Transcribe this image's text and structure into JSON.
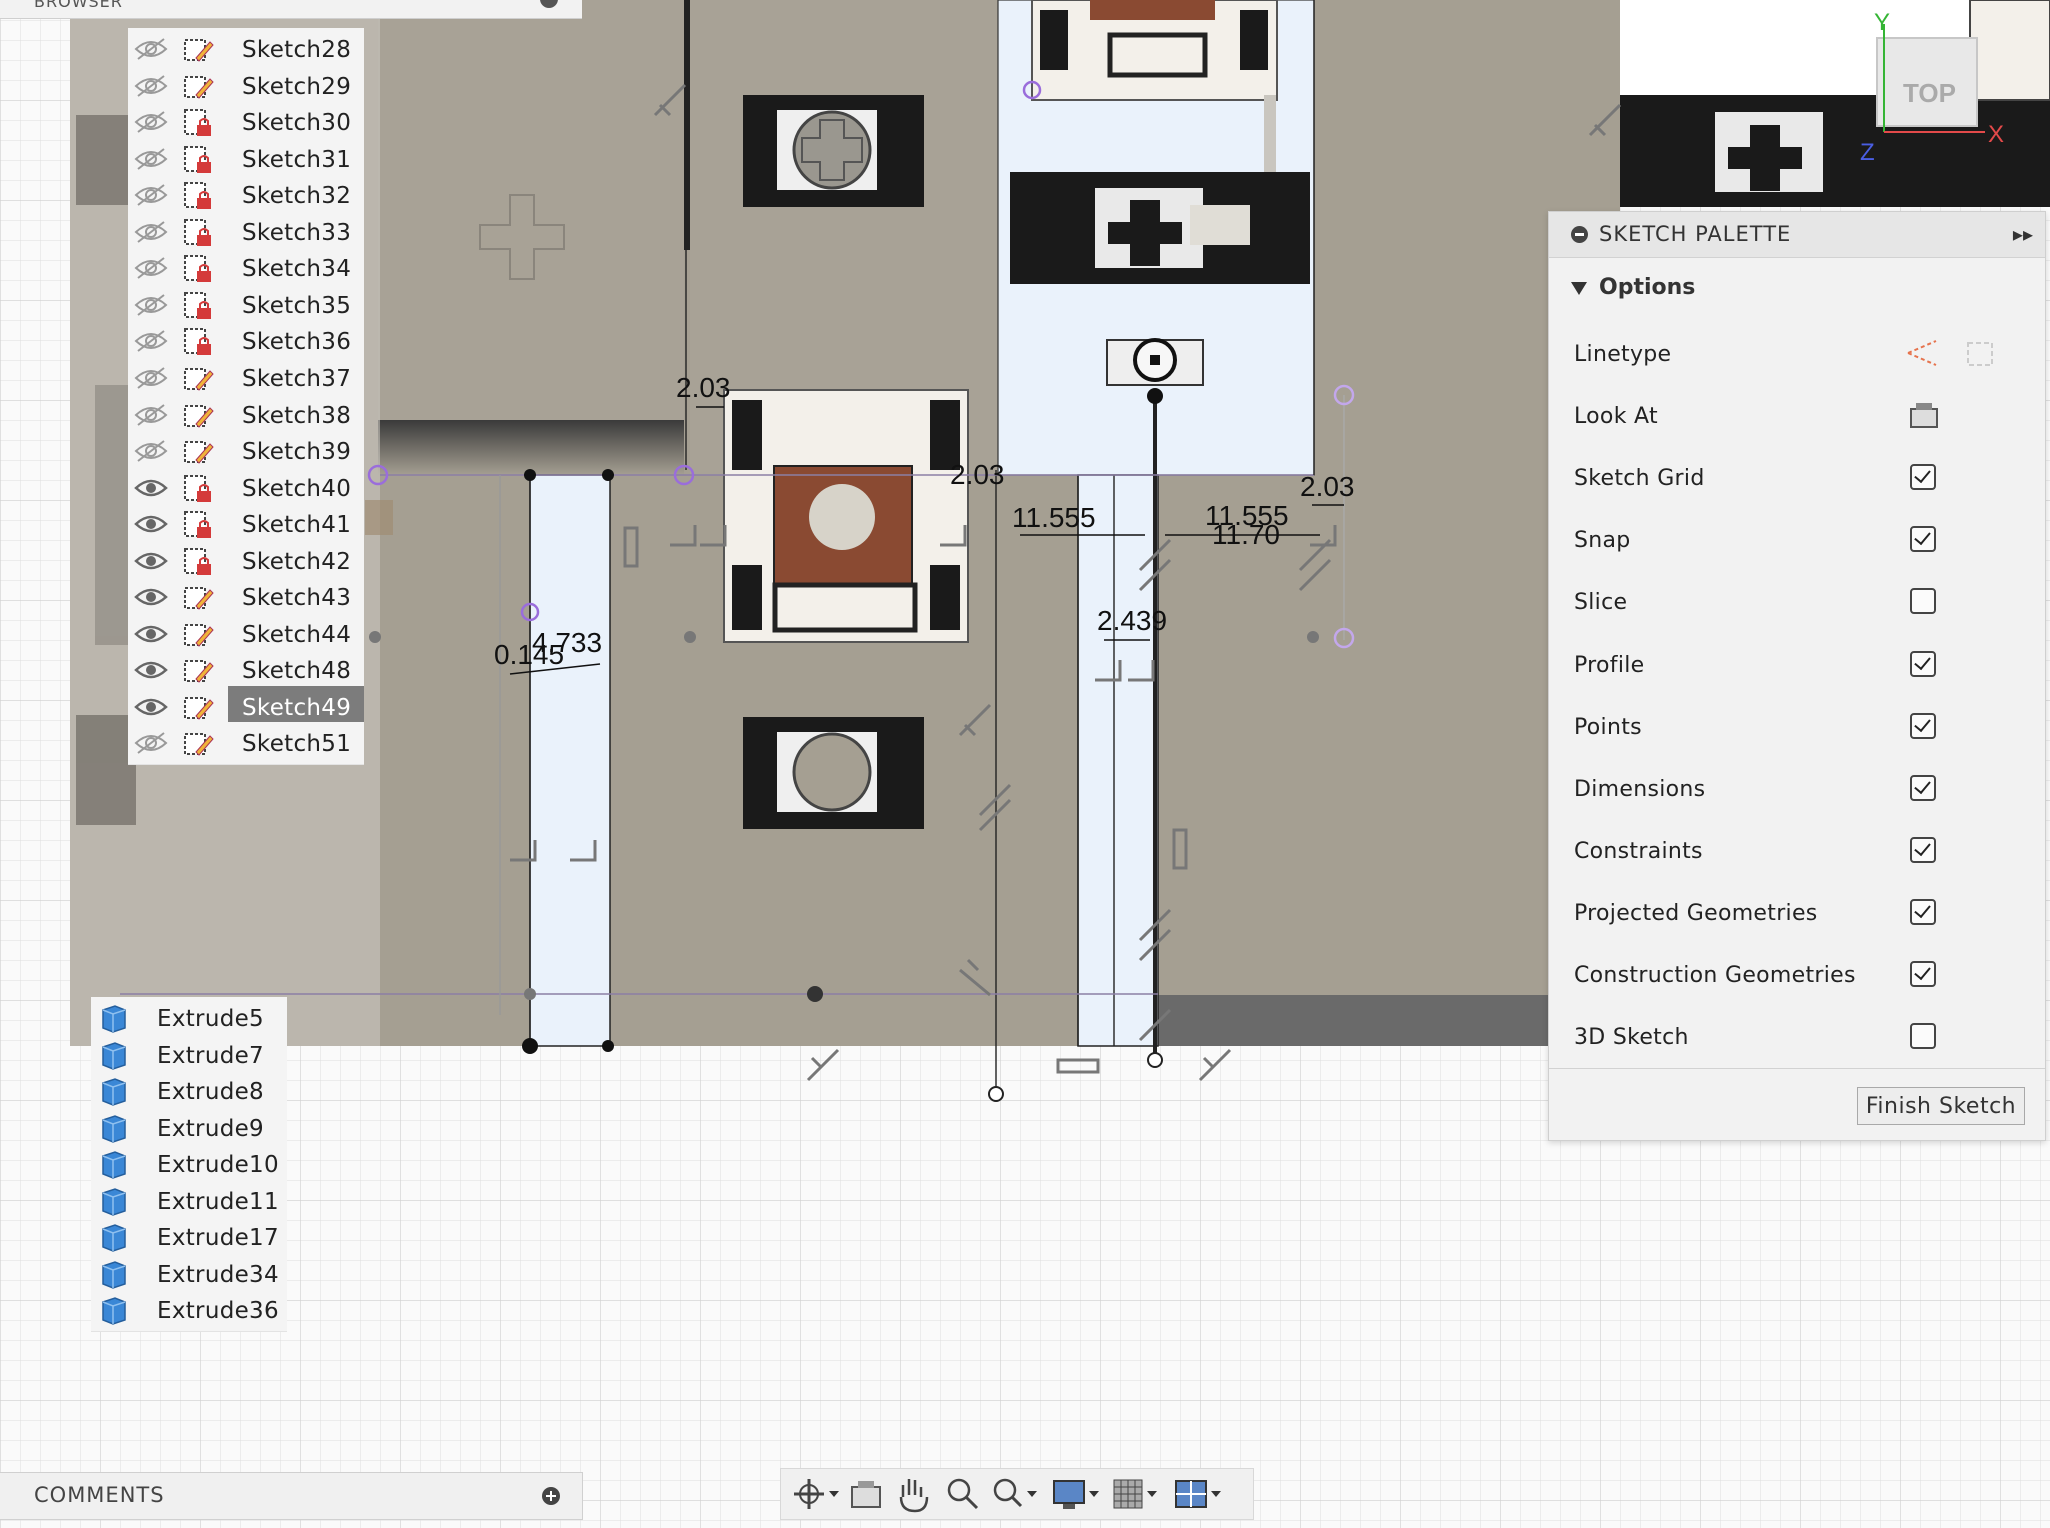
{
  "browser": {
    "header": "BROWSER",
    "sketches": [
      {
        "label": "Sketch28",
        "visible": false,
        "locked": false
      },
      {
        "label": "Sketch29",
        "visible": false,
        "locked": false
      },
      {
        "label": "Sketch30",
        "visible": false,
        "locked": true
      },
      {
        "label": "Sketch31",
        "visible": false,
        "locked": true
      },
      {
        "label": "Sketch32",
        "visible": false,
        "locked": true
      },
      {
        "label": "Sketch33",
        "visible": false,
        "locked": true
      },
      {
        "label": "Sketch34",
        "visible": false,
        "locked": true
      },
      {
        "label": "Sketch35",
        "visible": false,
        "locked": true
      },
      {
        "label": "Sketch36",
        "visible": false,
        "locked": true
      },
      {
        "label": "Sketch37",
        "visible": false,
        "locked": false
      },
      {
        "label": "Sketch38",
        "visible": false,
        "locked": false
      },
      {
        "label": "Sketch39",
        "visible": false,
        "locked": false
      },
      {
        "label": "Sketch40",
        "visible": true,
        "locked": true
      },
      {
        "label": "Sketch41",
        "visible": true,
        "locked": true
      },
      {
        "label": "Sketch42",
        "visible": true,
        "locked": true
      },
      {
        "label": "Sketch43",
        "visible": true,
        "locked": false
      },
      {
        "label": "Sketch44",
        "visible": true,
        "locked": false
      },
      {
        "label": "Sketch48",
        "visible": true,
        "locked": false
      },
      {
        "label": "Sketch49",
        "visible": true,
        "locked": false,
        "selected": true
      },
      {
        "label": "Sketch51",
        "visible": false,
        "locked": false
      }
    ],
    "bodies": [
      {
        "label": "Extrude5"
      },
      {
        "label": "Extrude7"
      },
      {
        "label": "Extrude8"
      },
      {
        "label": "Extrude9"
      },
      {
        "label": "Extrude10"
      },
      {
        "label": "Extrude11"
      },
      {
        "label": "Extrude17"
      },
      {
        "label": "Extrude34"
      },
      {
        "label": "Extrude36"
      }
    ]
  },
  "canvas": {
    "dimensions": [
      "2.03",
      "2.03",
      "11.555",
      "11.555",
      "2.03",
      "11.70",
      "4.733",
      "0.145",
      "2.439"
    ]
  },
  "viewcube": {
    "face": "TOP",
    "axis_y": "Y",
    "axis_x": "X",
    "axis_z": "Z"
  },
  "palette": {
    "title": "SKETCH PALETTE",
    "options_heading": "Options",
    "rows": [
      {
        "label": "Linetype",
        "control": "icons",
        "icon": "linetype-icon"
      },
      {
        "label": "Look At",
        "control": "icon",
        "icon": "look-at-icon"
      },
      {
        "label": "Sketch Grid",
        "control": "checkbox",
        "checked": true
      },
      {
        "label": "Snap",
        "control": "checkbox",
        "checked": true
      },
      {
        "label": "Slice",
        "control": "checkbox",
        "checked": false
      },
      {
        "label": "Profile",
        "control": "checkbox",
        "checked": true
      },
      {
        "label": "Points",
        "control": "checkbox",
        "checked": true
      },
      {
        "label": "Dimensions",
        "control": "checkbox",
        "checked": true
      },
      {
        "label": "Constraints",
        "control": "checkbox",
        "checked": true
      },
      {
        "label": "Projected Geometries",
        "control": "checkbox",
        "checked": true
      },
      {
        "label": "Construction Geometries",
        "control": "checkbox",
        "checked": true
      },
      {
        "label": "3D Sketch",
        "control": "checkbox",
        "checked": false
      }
    ],
    "finish_label": "Finish Sketch"
  },
  "comments": {
    "label": "COMMENTS"
  },
  "navbar": {
    "tools": [
      "orbit-icon",
      "look-at-icon",
      "pan-icon",
      "zoom-icon",
      "zoom-window-icon",
      "display-settings-icon",
      "grid-settings-icon",
      "viewports-icon"
    ]
  },
  "colors": {
    "table_beige": "#a59f92",
    "panel_blue": "#eaf2fb",
    "switch_brown": "#8a4a32",
    "selected_row": "#7c7c7c"
  }
}
